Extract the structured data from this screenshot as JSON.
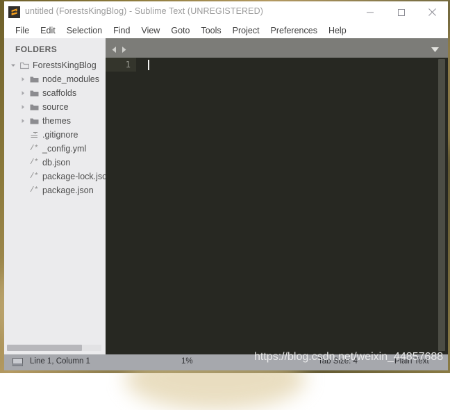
{
  "window": {
    "title": "untitled (ForestsKingBlog) - Sublime Text (UNREGISTERED)",
    "logo_icon": "sublime-text-logo",
    "controls": {
      "minimize": "minimize-icon",
      "maximize": "maximize-icon",
      "close": "close-icon"
    }
  },
  "menubar": {
    "items": [
      {
        "label": "File"
      },
      {
        "label": "Edit"
      },
      {
        "label": "Selection"
      },
      {
        "label": "Find"
      },
      {
        "label": "View"
      },
      {
        "label": "Goto"
      },
      {
        "label": "Tools"
      },
      {
        "label": "Project"
      },
      {
        "label": "Preferences"
      },
      {
        "label": "Help"
      }
    ]
  },
  "sidebar": {
    "header": "FOLDERS",
    "root": {
      "label": "ForestsKingBlog",
      "icon": "folder-open-icon",
      "expanded": true,
      "twisty": "chevron-down-icon"
    },
    "folders": [
      {
        "label": "node_modules",
        "icon": "folder-icon",
        "twisty": "chevron-right-icon",
        "expanded": false
      },
      {
        "label": "scaffolds",
        "icon": "folder-icon",
        "twisty": "chevron-right-icon",
        "expanded": false
      },
      {
        "label": "source",
        "icon": "folder-icon",
        "twisty": "chevron-right-icon",
        "expanded": false
      },
      {
        "label": "themes",
        "icon": "folder-icon",
        "twisty": "chevron-right-icon",
        "expanded": false
      }
    ],
    "files": [
      {
        "label": ".gitignore",
        "icon": "text-lines-icon",
        "icon_text": ""
      },
      {
        "label": "_config.yml",
        "icon": "source-file-icon",
        "icon_text": "/*"
      },
      {
        "label": "db.json",
        "icon": "source-file-icon",
        "icon_text": "/*"
      },
      {
        "label": "package-lock.json",
        "icon": "source-file-icon",
        "icon_text": "/*"
      },
      {
        "label": "package.json",
        "icon": "source-file-icon",
        "icon_text": "/*"
      }
    ]
  },
  "tabbar": {
    "scroll_left_icon": "triangle-left-icon",
    "scroll_right_icon": "triangle-right-icon",
    "menu_icon": "triangle-down-icon"
  },
  "editor": {
    "line_numbers": [
      "1"
    ],
    "content": "",
    "caret_visible": true
  },
  "statusbar": {
    "monitor_icon": "monitor-icon",
    "cursor_position": "Line 1, Column 1",
    "zoom": "1%",
    "tab_size": "Tab Size: 4",
    "syntax": "Plain Text"
  },
  "watermark": {
    "text": "https://blog.csdn.net/weixin_44857688"
  },
  "colors": {
    "editor_background": "#272822",
    "sidebar_background": "#ebebed",
    "tabbar_background": "#7c7c78",
    "statusbar_background": "#a6a8ad",
    "logo_accent": "#f8a01c"
  }
}
